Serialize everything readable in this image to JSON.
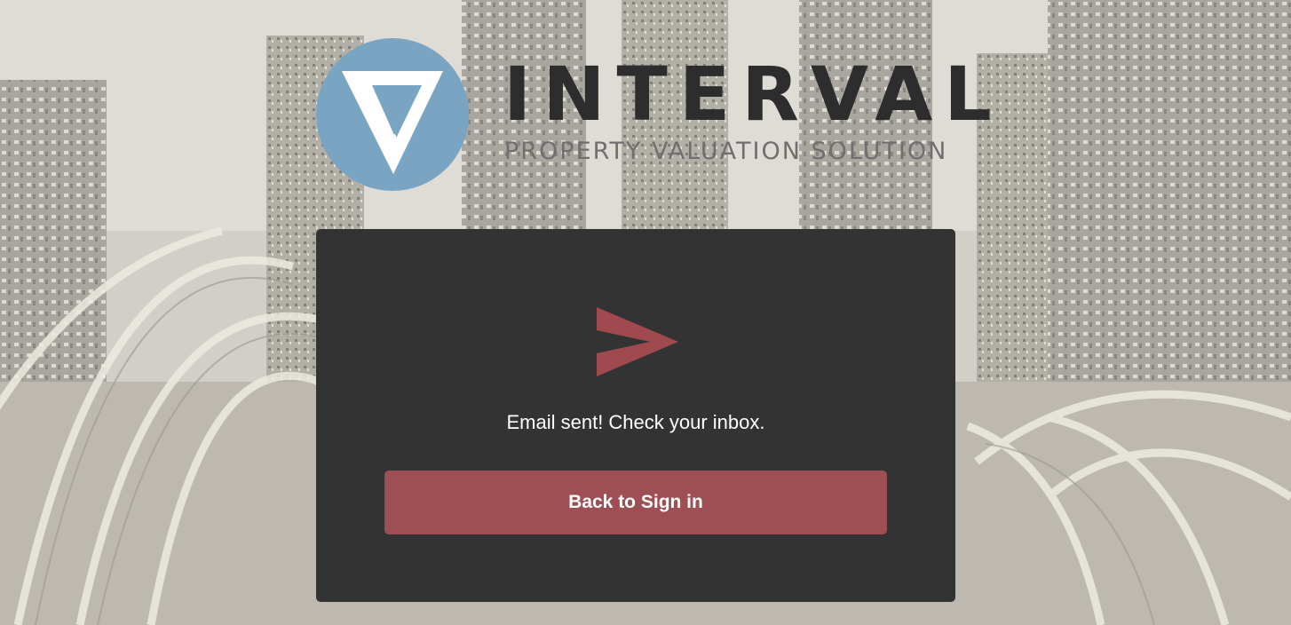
{
  "brand": {
    "name": "INTERVAL",
    "tagline": "PROPERTY VALUATION SOLUTION",
    "emblem_icon": "interval-v-logo-icon",
    "emblem_color": "#7aa5c2",
    "wordmark_color": "#2d2d2d",
    "tagline_color": "#6f6f6f"
  },
  "card": {
    "icon": "paper-plane-send-icon",
    "icon_color": "#a04a50",
    "message": "Email sent! Check your inbox.",
    "back_button_label": "Back to Sign in",
    "background_color": "#333333",
    "button_color": "#9e4f53"
  }
}
